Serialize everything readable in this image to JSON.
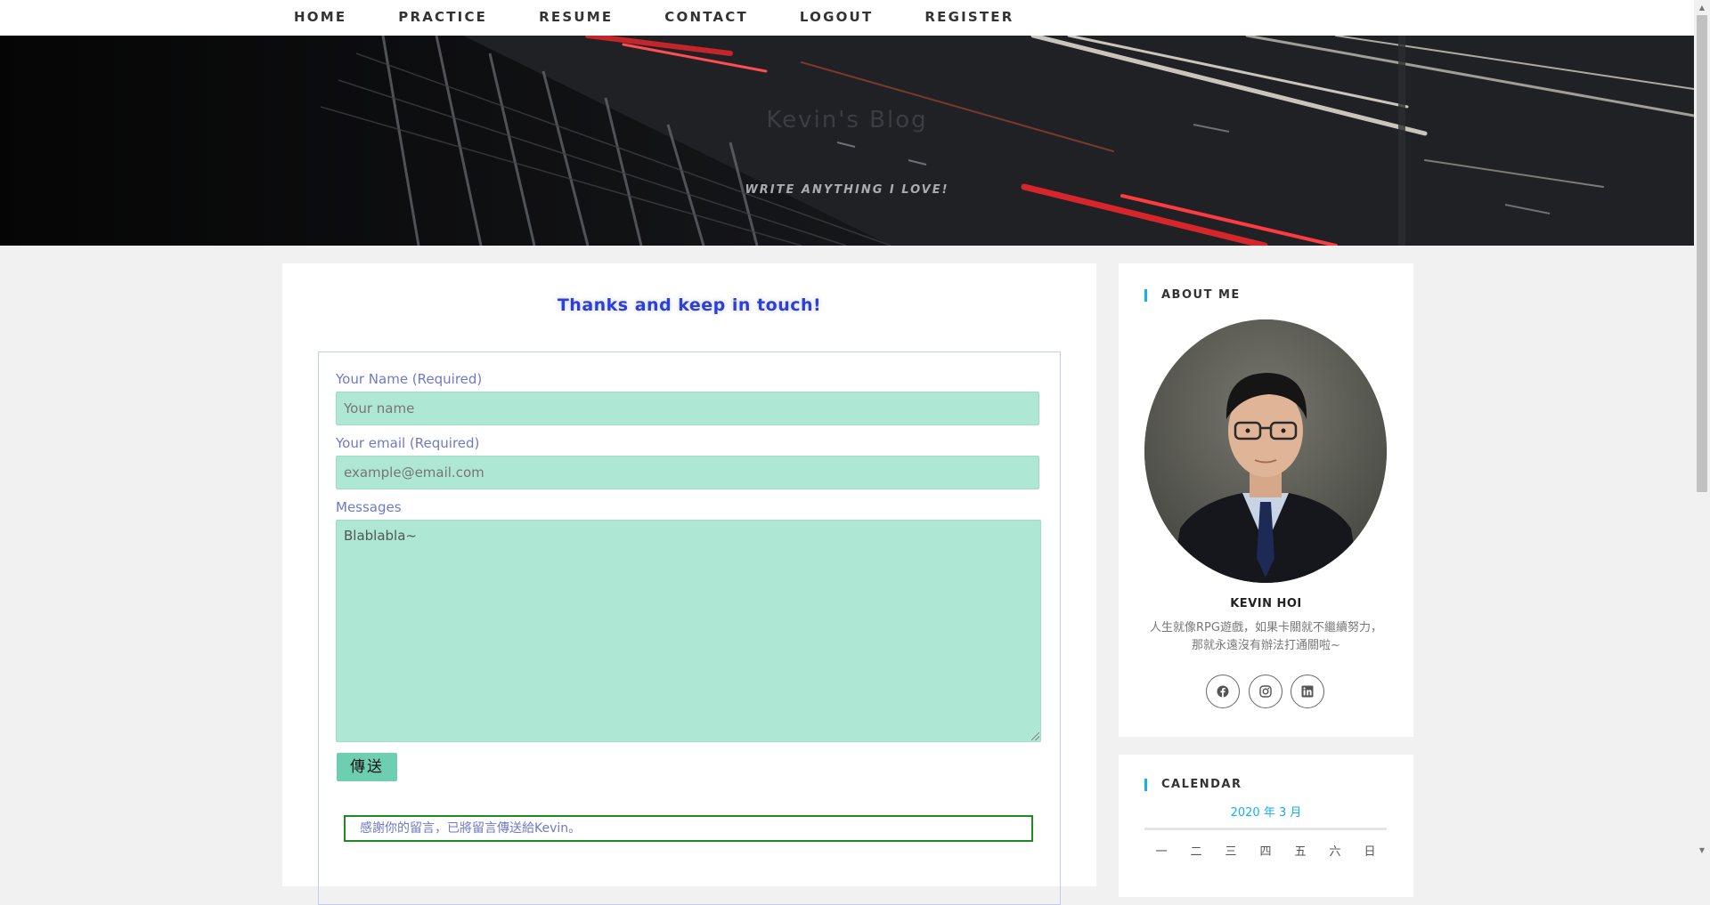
{
  "nav": {
    "items": [
      {
        "label": "HOME"
      },
      {
        "label": "PRACTICE"
      },
      {
        "label": "RESUME"
      },
      {
        "label": "CONTACT"
      },
      {
        "label": "LOGOUT"
      },
      {
        "label": "REGISTER"
      }
    ]
  },
  "hero": {
    "title": "Kevin's Blog",
    "tagline": "WRITE ANYTHING I LOVE!"
  },
  "contact": {
    "heading": "Thanks and keep in touch!",
    "name_label": "Your Name (Required)",
    "name_placeholder": "Your name",
    "email_label": "Your email (Required)",
    "email_placeholder": "example@email.com",
    "message_label": "Messages",
    "message_placeholder": "Blablabla~",
    "submit_label": "傳送",
    "success_message": "感謝你的留言，已將留言傳送給Kevin。"
  },
  "sidebar": {
    "about_title": "ABOUT ME",
    "author_name": "KEVIN HOI",
    "bio_line1": "人生就像RPG遊戲，如果卡關就不繼續努力，",
    "bio_line2": "那就永遠沒有辦法打通關啦~",
    "social": [
      {
        "icon": "facebook-icon"
      },
      {
        "icon": "instagram-icon"
      },
      {
        "icon": "linkedin-icon"
      }
    ],
    "calendar_title": "CALENDAR",
    "calendar_month": "2020 年 3 月",
    "weekdays": [
      "一",
      "二",
      "三",
      "四",
      "五",
      "六",
      "日"
    ]
  },
  "colors": {
    "accent": "#13aff0",
    "heading_blue": "#2c3fd6",
    "field_bg": "#afe7d5",
    "button_bg": "#6dcfb0",
    "success_border": "#1e8b1e",
    "label_color": "#6f79c9"
  }
}
